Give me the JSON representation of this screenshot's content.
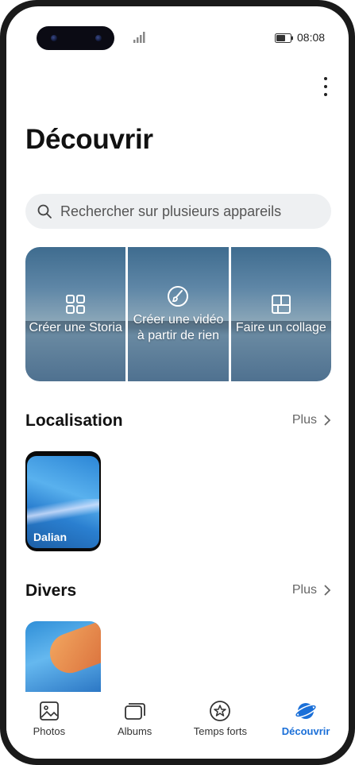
{
  "status_bar": {
    "time": "08:08"
  },
  "header": {
    "title": "Découvrir"
  },
  "search": {
    "placeholder": "Rechercher sur plusieurs appareils"
  },
  "tiles": [
    {
      "label": "Créer une Storia",
      "icon": "grid-icon"
    },
    {
      "label_line1": "Créer une vidéo",
      "label_line2": "à partir de rien",
      "icon": "brush-icon"
    },
    {
      "label": "Faire un collage",
      "icon": "collage-icon"
    }
  ],
  "sections": {
    "location": {
      "title": "Localisation",
      "more": "Plus",
      "item_label": "Dalian"
    },
    "misc": {
      "title": "Divers",
      "more": "Plus"
    }
  },
  "nav": {
    "items": [
      {
        "label": "Photos",
        "icon": "photos-icon"
      },
      {
        "label": "Albums",
        "icon": "albums-icon"
      },
      {
        "label": "Temps forts",
        "icon": "star-icon"
      },
      {
        "label": "Découvrir",
        "icon": "discover-planet-icon"
      }
    ],
    "active_index": 3
  },
  "colors": {
    "accent": "#1a6fd8",
    "search_bg": "#eef0f2"
  }
}
